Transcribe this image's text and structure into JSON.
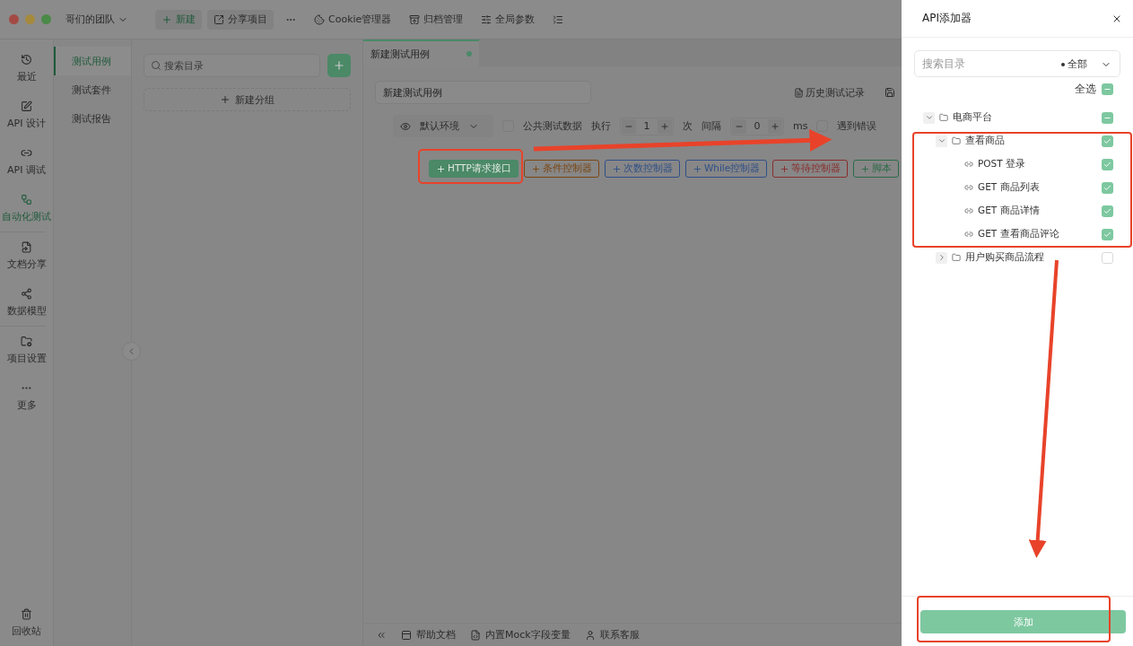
{
  "window": {
    "team": "哥们的团队"
  },
  "toolbar": [
    {
      "kind": "new",
      "label": "新建"
    },
    {
      "kind": "share",
      "label": "分享项目"
    },
    {
      "kind": "more"
    },
    {
      "kind": "cookie",
      "label": "Cookie管理器"
    },
    {
      "kind": "archive",
      "label": "归档管理"
    },
    {
      "kind": "params",
      "label": "全局参数"
    },
    {
      "kind": "collapse"
    }
  ],
  "nav": [
    {
      "label": "最近",
      "selected": false
    },
    {
      "label": "API 设计",
      "selected": false
    },
    {
      "label": "API 调试",
      "selected": false
    },
    {
      "label": "自动化测试",
      "selected": true
    },
    {
      "label": "文档分享",
      "selected": false
    },
    {
      "label": "数据模型",
      "selected": false
    },
    {
      "label": "项目设置",
      "selected": false
    },
    {
      "label": "更多",
      "selected": false
    }
  ],
  "nav_bottom": {
    "label": "回收站"
  },
  "sub_nav": [
    {
      "label": "测试用例",
      "selected": true
    },
    {
      "label": "测试套件",
      "selected": false
    },
    {
      "label": "测试报告",
      "selected": false
    }
  ],
  "tree_panel": {
    "search_placeholder": "搜索目录",
    "new_group": "新建分组"
  },
  "tabs": [
    {
      "label": "新建测试用例",
      "selected": true,
      "modified": true
    }
  ],
  "case": {
    "name": "新建测试用例",
    "history": "历史测试记录"
  },
  "run_options": {
    "environment": "默认环境",
    "public_data": {
      "label": "公共测试数据",
      "checked": false
    },
    "repeat_label": "执行",
    "repeat": "1",
    "repeat_unit": "次",
    "interval_label": "间隔",
    "interval": "0",
    "interval_unit": "ms",
    "stop_on_error": {
      "label": "遇到错误",
      "checked": false
    }
  },
  "controllers": [
    {
      "label": "HTTP请求接口",
      "color": "#4b8967",
      "filled": true
    },
    {
      "label": "条件控制器",
      "color": "#7a4612",
      "filled": false
    },
    {
      "label": "次数控制器",
      "color": "#2f4f88",
      "filled": false
    },
    {
      "label": "While控制器",
      "color": "#2f4f88",
      "filled": false
    },
    {
      "label": "等待控制器",
      "color": "#8a2c2c",
      "filled": false
    },
    {
      "label": "脚本",
      "color": "#2c6a48",
      "filled": false
    }
  ],
  "status_bar": [
    {
      "kind": "help",
      "label": "帮助文档"
    },
    {
      "kind": "mock",
      "label": "内置Mock字段变量"
    },
    {
      "kind": "support",
      "label": "联系客服"
    }
  ],
  "drawer": {
    "title": "API添加器",
    "search_placeholder": "搜索目录",
    "filter": "全部",
    "select_all": {
      "label": "全选",
      "checked": true,
      "indeterminate": true
    },
    "tree": [
      {
        "kind": "folder",
        "name": "电商平台",
        "expanded": true,
        "checked": true,
        "indeterminate": true,
        "children": [
          {
            "kind": "folder",
            "name": "查看商品",
            "expanded": true,
            "checked": true,
            "indeterminate": false,
            "children": [
              {
                "kind": "endpoint",
                "method": "POST",
                "name": "登录",
                "checked": true,
                "indeterminate": false
              },
              {
                "kind": "endpoint",
                "method": "GET",
                "name": "商品列表",
                "checked": true,
                "indeterminate": false
              },
              {
                "kind": "endpoint",
                "method": "GET",
                "name": "商品详情",
                "checked": true,
                "indeterminate": false
              },
              {
                "kind": "endpoint",
                "method": "GET",
                "name": "查看商品评论",
                "checked": true,
                "indeterminate": false
              }
            ]
          },
          {
            "kind": "folder",
            "name": "用户购买商品流程",
            "expanded": false,
            "checked": false,
            "indeterminate": false
          }
        ]
      }
    ],
    "add_button": "添加"
  }
}
